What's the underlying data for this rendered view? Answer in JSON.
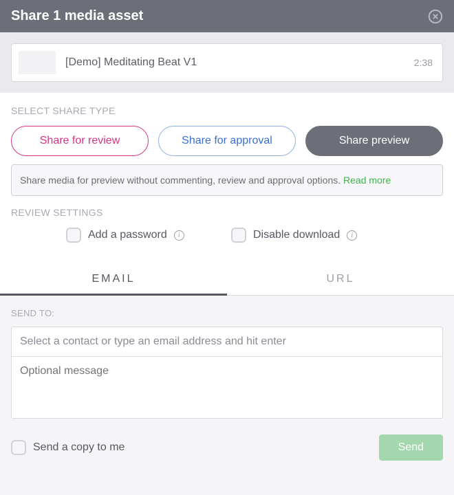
{
  "header": {
    "title": "Share 1 media asset"
  },
  "media": {
    "title": "[Demo] Meditating Beat V1",
    "duration": "2:38"
  },
  "share_type": {
    "label": "SELECT SHARE TYPE",
    "review": "Share for review",
    "approval": "Share for approval",
    "preview": "Share preview",
    "info_text": "Share media for preview without commenting, review and approval options. ",
    "info_link": "Read more"
  },
  "review_settings": {
    "label": "REVIEW SETTINGS",
    "password": "Add a password",
    "disable_download": "Disable download"
  },
  "tabs": {
    "email": "EMAIL",
    "url": "URL"
  },
  "email": {
    "send_to": "SEND TO:",
    "contact_placeholder": "Select a contact or type an email address and hit enter",
    "message_placeholder": "Optional message"
  },
  "footer": {
    "copy": "Send a copy to me",
    "send": "Send"
  }
}
